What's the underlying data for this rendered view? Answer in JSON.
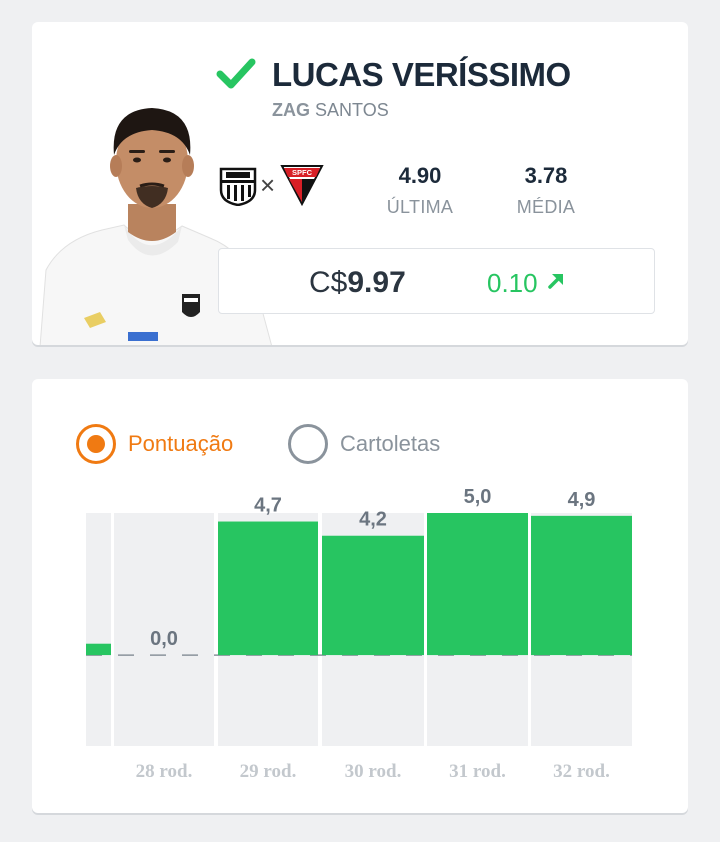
{
  "player": {
    "name": "LUCAS VERÍSSIMO",
    "position": "ZAG",
    "club": "SANTOS",
    "status_icon": "check-icon",
    "status_color": "#27c561",
    "match": {
      "home": "Santos",
      "separator": "×",
      "away": "SPFC"
    },
    "last_score": "4.90",
    "last_label": "ÚLTIMA",
    "avg_score": "3.78",
    "avg_label": "MÉDIA",
    "price_currency": "C$",
    "price_value": "9.97",
    "variation": "0.10",
    "variation_icon": "arrow-up-right-icon"
  },
  "toggle": {
    "options": [
      "Pontuação",
      "Cartoletas"
    ],
    "selected": "Pontuação",
    "accent": "#f07a12"
  },
  "chart_data": {
    "type": "bar",
    "categories": [
      "",
      "28 rod.",
      "29 rod.",
      "30 rod.",
      "31 rod.",
      "32 rod."
    ],
    "values": [
      0.4,
      0.0,
      4.7,
      4.2,
      5.0,
      4.9
    ],
    "value_labels": [
      "",
      "0,0",
      "4,7",
      "4,2",
      "5,0",
      "4,9"
    ],
    "ylim": [
      -3.2,
      5.0
    ],
    "bar_color": "#27c561",
    "legend": "none",
    "grid": false
  }
}
